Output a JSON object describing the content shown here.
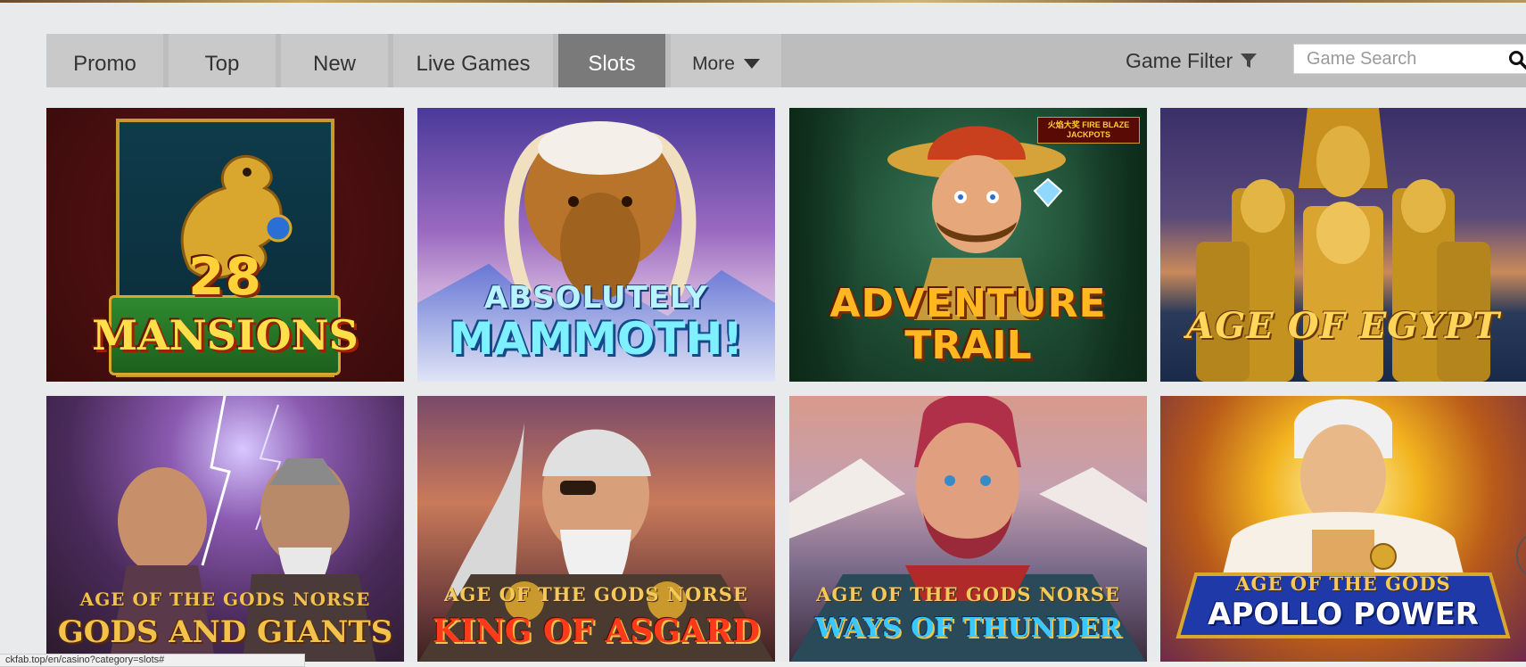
{
  "nav": {
    "tabs": [
      {
        "label": "Promo",
        "active": false
      },
      {
        "label": "Top",
        "active": false
      },
      {
        "label": "New",
        "active": false
      },
      {
        "label": "Live Games",
        "active": false
      },
      {
        "label": "Slots",
        "active": true
      }
    ],
    "more_label": "More",
    "filter_label": "Game Filter",
    "search_placeholder": "Game Search"
  },
  "games": [
    {
      "title": "28",
      "subtitle": "MANSIONS"
    },
    {
      "title": "ABSOLUTELY",
      "subtitle": "MAMMOTH!"
    },
    {
      "title": "ADVENTURE",
      "subtitle": "TRAIL",
      "badge": "火焰大奖 FIRE BLAZE JACKPOTS"
    },
    {
      "title": "AGE OF EGYPT",
      "subtitle": ""
    },
    {
      "title": "AGE OF THE GODS NORSE",
      "subtitle": "GODS AND GIANTS"
    },
    {
      "title": "AGE OF THE GODS NORSE",
      "subtitle": "KING OF ASGARD"
    },
    {
      "title": "AGE OF THE GODS NORSE",
      "subtitle": "WAYS OF THUNDER"
    },
    {
      "title": "AGE OF THE GODS",
      "subtitle": "APOLLO POWER"
    }
  ],
  "status_url": "ckfab.top/en/casino?category=slots#",
  "colors": {
    "page_bg": "#e9eaec",
    "nav_bg": "#bdbdbd",
    "tab_bg": "#c9c9c9",
    "tab_active_bg": "#7a7a7a"
  }
}
